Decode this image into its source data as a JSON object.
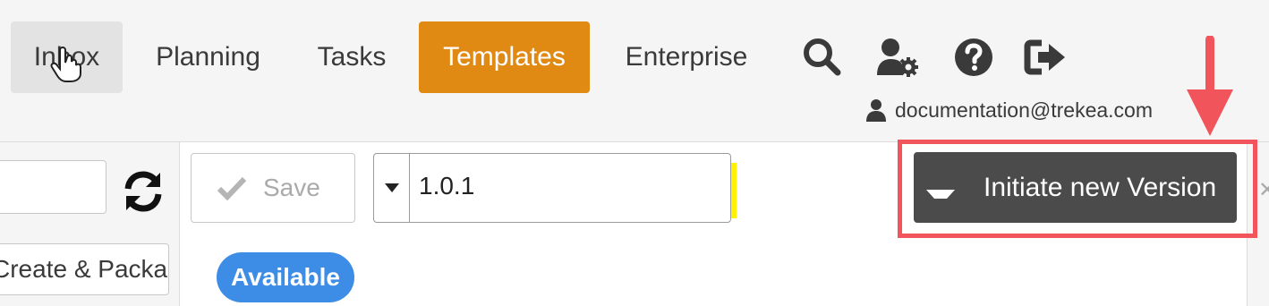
{
  "nav": {
    "items": [
      {
        "label": "Inbox"
      },
      {
        "label": "Planning"
      },
      {
        "label": "Tasks"
      },
      {
        "label": "Templates",
        "active": true
      },
      {
        "label": "Enterprise"
      }
    ],
    "icons": [
      "search-icon",
      "user-settings-icon",
      "help-icon",
      "logout-icon"
    ],
    "active_color": "#e08a14"
  },
  "user": {
    "email": "documentation@trekea.com"
  },
  "toolbar": {
    "save_label": "Save",
    "version_value": "1.0.1",
    "initiate_label": "Initiate new Version"
  },
  "left_panel": {
    "package_button_label": "Create & Package"
  },
  "status": {
    "badge": "Available",
    "badge_color": "#3d8de6"
  },
  "annotations": {
    "highlight_color": "#fff200",
    "callout_color": "#f2545b"
  }
}
